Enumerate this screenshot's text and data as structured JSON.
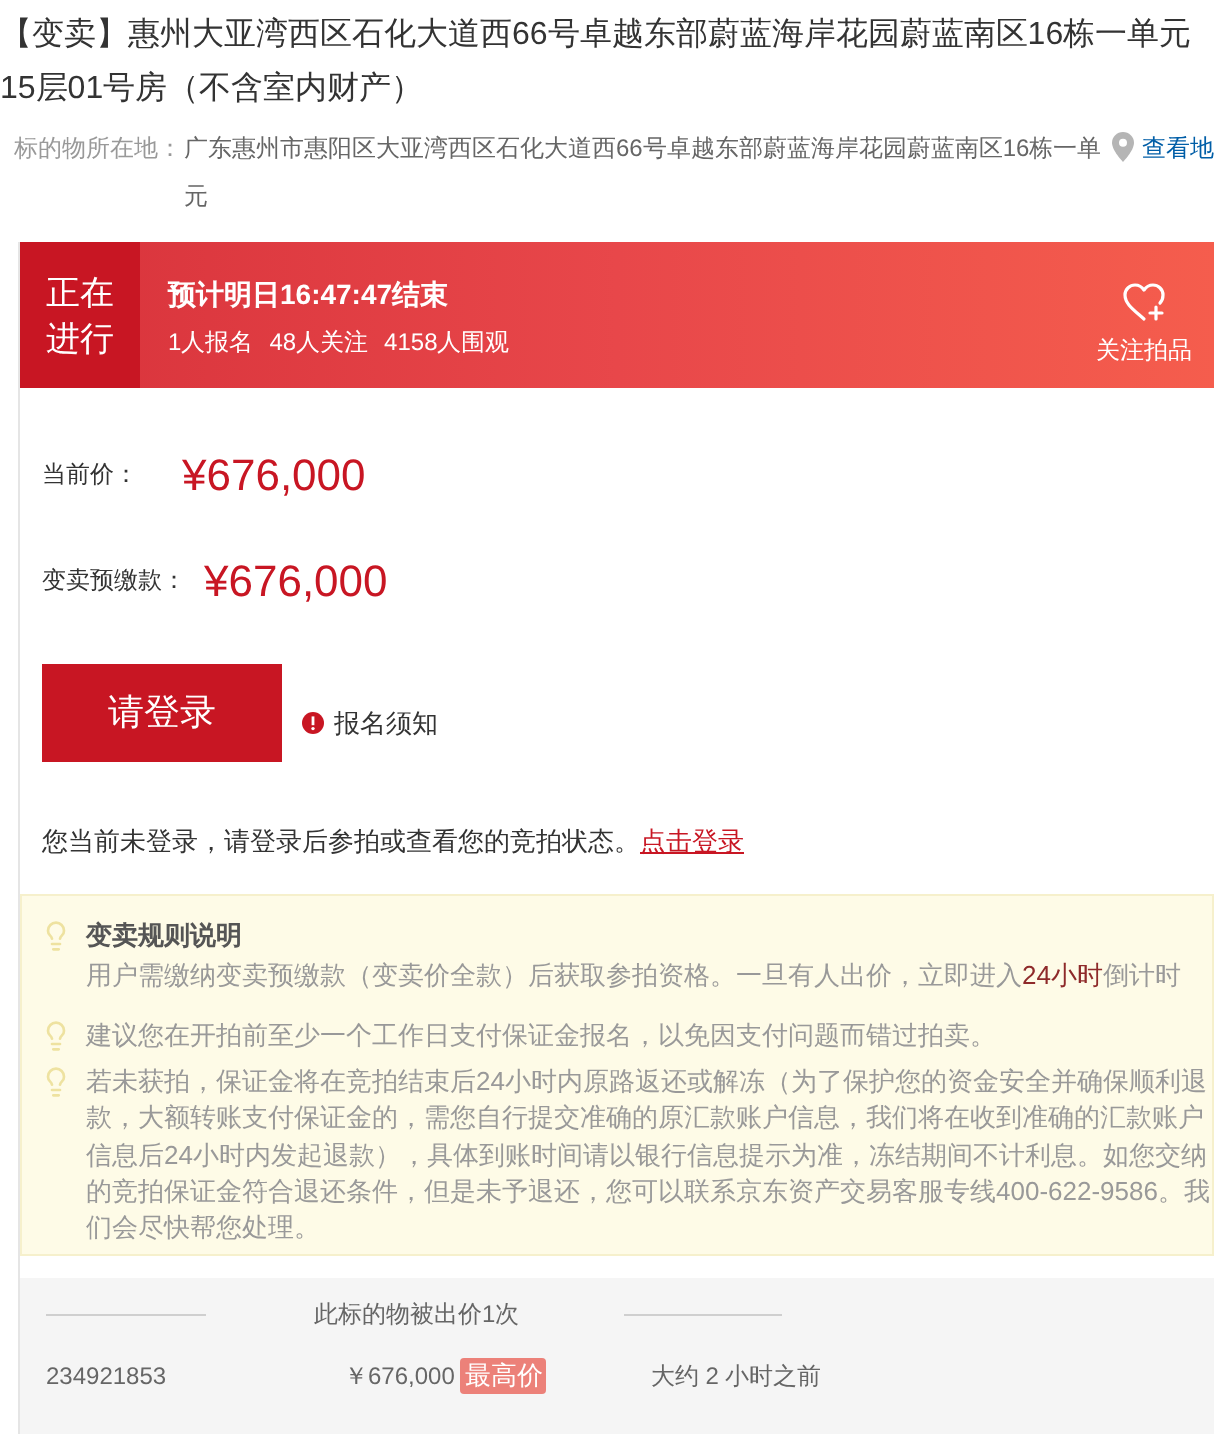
{
  "title": "【变卖】惠州大亚湾西区石化大道西66号卓越东部蔚蓝海岸花园蔚蓝南区16栋一单元15层01号房（不含室内财产）",
  "location": {
    "label": "标的物所在地：",
    "address": "广东惠州市惠阳区大亚湾西区石化大道西66号卓越东部蔚蓝海岸花园蔚蓝南区16栋一单元",
    "map_link": "查看地"
  },
  "status_banner": {
    "status": "正在进行",
    "end_time": "预计明日16:47:47结束",
    "stats": [
      "1人报名",
      "48人关注",
      "4158人围观"
    ],
    "follow_label": "关注拍品"
  },
  "current_price": {
    "label": "当前价：",
    "value": "¥676,000"
  },
  "deposit": {
    "label": "变卖预缴款：",
    "value": "¥676,000"
  },
  "login_button": "请登录",
  "notice_link": "报名须知",
  "login_hint": {
    "text": "您当前未登录，请登录后参拍或查看您的竞拍状态。",
    "link": "点击登录"
  },
  "tips": [
    {
      "title": "变卖规则说明",
      "segments": [
        {
          "text": "用户需缴纳变卖预缴款（变卖价全款）后获取参拍资格。一旦有人出价，立即进入",
          "highlight": false
        },
        {
          "text": "24小时",
          "highlight": true
        },
        {
          "text": "倒计时",
          "highlight": false
        }
      ]
    },
    {
      "segments": [
        {
          "text": "建议您在开拍前至少一个工作日支付保证金报名，以免因支付问题而错过拍卖。",
          "highlight": false
        }
      ]
    },
    {
      "segments": [
        {
          "text": "若未获拍，保证金将在竞拍结束后24小时内原路返还或解冻（为了保护您的资金安全并确保顺利退款，大额转账支付保证金的，需您自行提交准确的原汇款账户信息，我们将在收到准确的汇款账户信息后24小时内发起退款），具体到账时间请以银行信息提示为准，冻结期间不计利息。如您交纳的竞拍保证金符合退还条件，但是未予退还，您可以联系京东资产交易客服专线400-622-9586。我们会尽快帮您处理。",
          "highlight": false
        }
      ]
    }
  ],
  "bid_history": {
    "heading": "此标的物被出价1次",
    "rows": [
      {
        "bidder": "234921853",
        "price": "￥676,000",
        "badge": "最高价",
        "time": "大约 2 小时之前"
      }
    ]
  }
}
